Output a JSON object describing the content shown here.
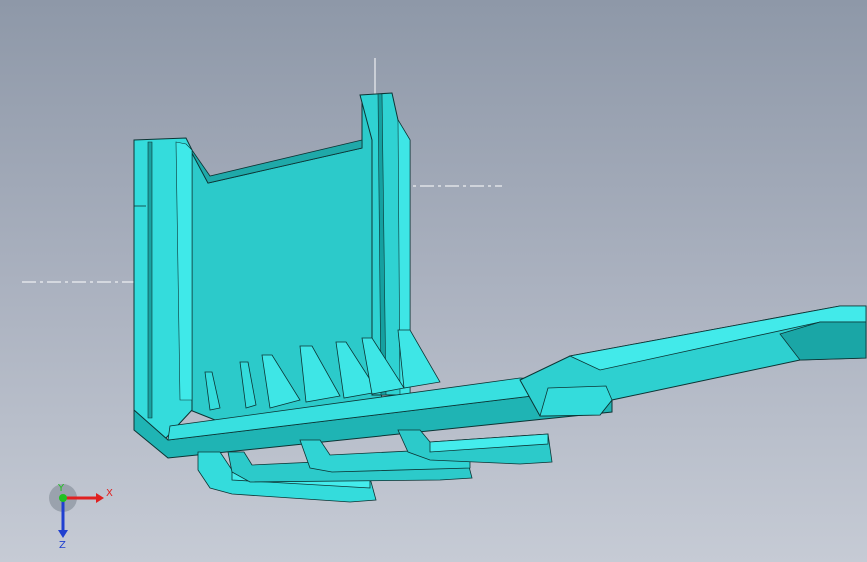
{
  "viewport": {
    "background_top": "#8e98a8",
    "background_bottom": "#c6cbd5"
  },
  "model": {
    "face_color": "#27c6c6",
    "face_light": "#3ee6e6",
    "face_dark": "#139a9a",
    "edge_color": "#0c3434"
  },
  "triad": {
    "x_label": "X",
    "y_label": "Y",
    "z_label": "Z",
    "x_color": "#e02020",
    "y_color": "#20c020",
    "z_color": "#2040d0"
  }
}
